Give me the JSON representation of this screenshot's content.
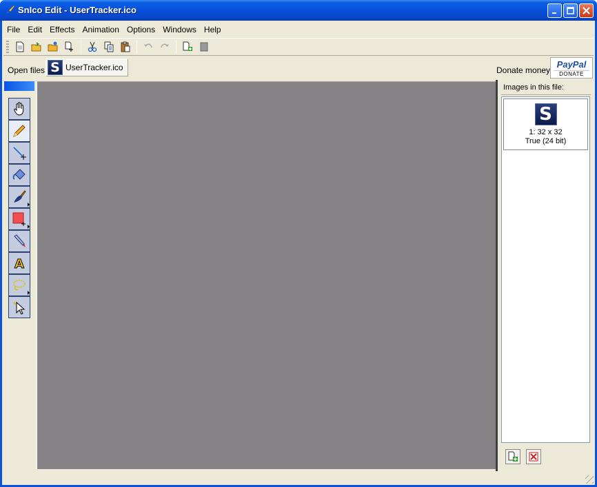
{
  "window": {
    "title": "SnIco Edit - UserTracker.ico",
    "minimize": "minimize",
    "maximize": "maximize",
    "close": "close"
  },
  "menu": [
    "File",
    "Edit",
    "Effects",
    "Animation",
    "Options",
    "Windows",
    "Help"
  ],
  "toolbar": {
    "buttons": [
      "new-icon",
      "open-icon",
      "open-folder-icon",
      "new-from-icon",
      "cut-icon",
      "copy-icon",
      "paste-icon",
      "undo-icon",
      "redo-icon",
      "add-image-icon",
      "delete-image-icon"
    ]
  },
  "openbar": {
    "label": "Open files:",
    "file_name": "UserTracker.ico",
    "file_icon_letter": "S",
    "donate_label": "Donate money:",
    "paypal_text": "PayPal",
    "paypal_sub": "DONATE"
  },
  "tools": [
    "hand-tool",
    "pencil-tool",
    "line-tool",
    "fill-tool",
    "brush-tool",
    "rectangle-tool",
    "color-picker-tool",
    "text-tool",
    "lasso-tool",
    "select-tool"
  ],
  "images_panel": {
    "title": "Images in this file:",
    "items": [
      {
        "letter": "S",
        "size": "1: 32 x 32",
        "depth": "True (24 bit)"
      }
    ]
  },
  "colors": {
    "canvas": "#858386",
    "titlebar": "#0a5fe6",
    "client": "#ece9d8"
  }
}
